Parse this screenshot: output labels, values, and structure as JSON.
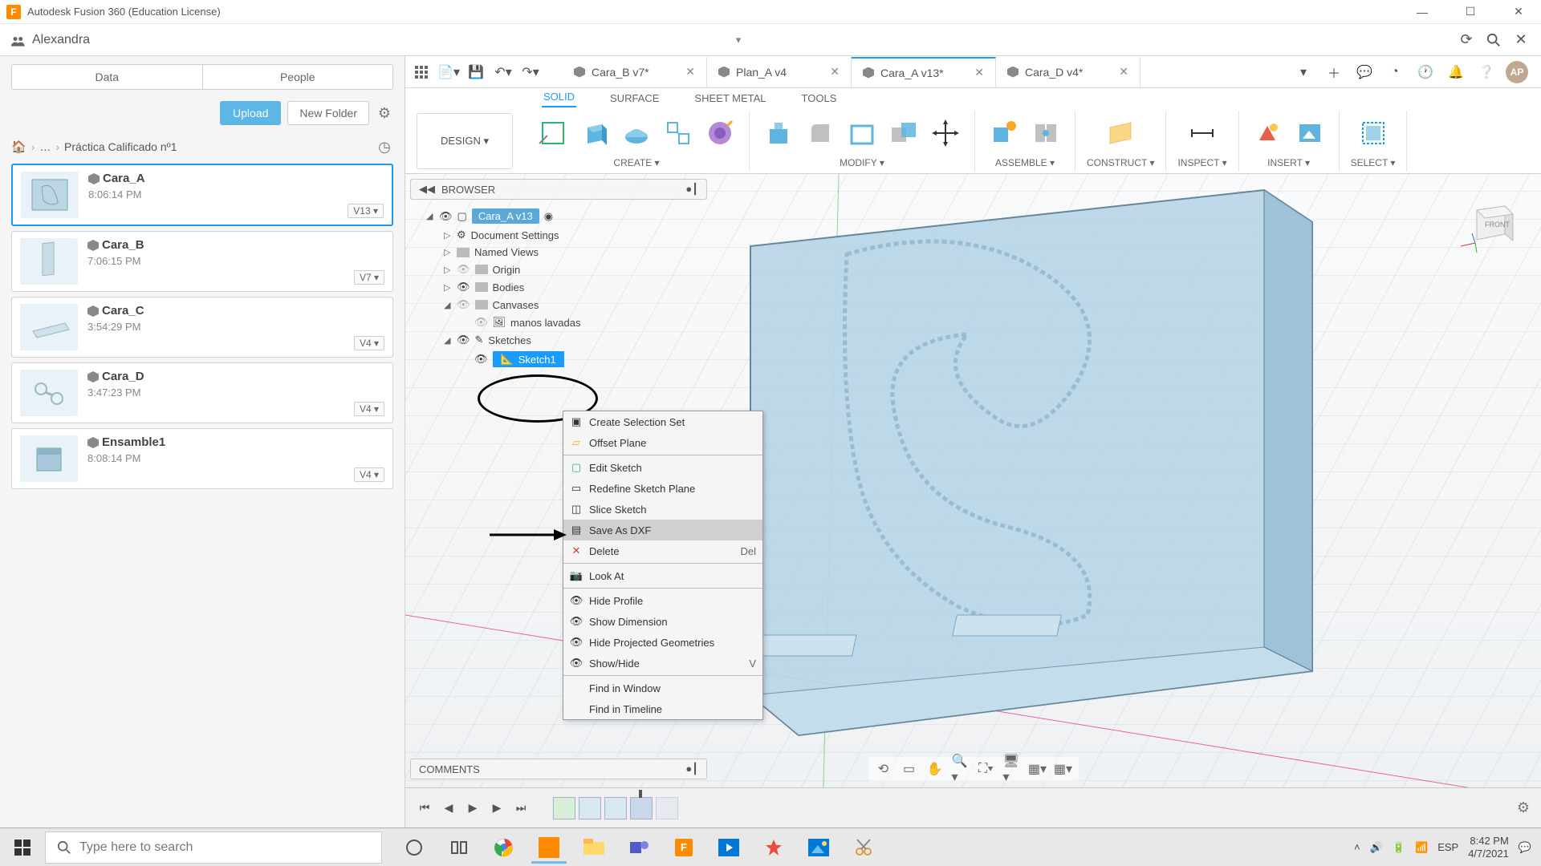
{
  "titlebar": {
    "app_name": "Autodesk Fusion 360 (Education License)"
  },
  "userbar": {
    "username": "Alexandra"
  },
  "left_panel": {
    "tabs": {
      "data": "Data",
      "people": "People"
    },
    "upload": "Upload",
    "new_folder": "New Folder",
    "breadcrumb": "Práctica Calificado nº1",
    "items": [
      {
        "name": "Cara_A",
        "time": "8:06:14 PM",
        "version": "V13 ▾"
      },
      {
        "name": "Cara_B",
        "time": "7:06:15 PM",
        "version": "V7 ▾"
      },
      {
        "name": "Cara_C",
        "time": "3:54:29 PM",
        "version": "V4 ▾"
      },
      {
        "name": "Cara_D",
        "time": "3:47:23 PM",
        "version": "V4 ▾"
      },
      {
        "name": "Ensamble1",
        "time": "8:08:14 PM",
        "version": "V4 ▾"
      }
    ]
  },
  "doc_tabs": [
    {
      "label": "Cara_B v7*"
    },
    {
      "label": "Plan_A v4"
    },
    {
      "label": "Cara_A v13*"
    },
    {
      "label": "Cara_D v4*"
    }
  ],
  "ribbon": {
    "design": "DESIGN ▾",
    "tabs": {
      "solid": "SOLID",
      "surface": "SURFACE",
      "sheet": "SHEET METAL",
      "tools": "TOOLS"
    },
    "groups": {
      "create": "CREATE ▾",
      "modify": "MODIFY ▾",
      "assemble": "ASSEMBLE ▾",
      "construct": "CONSTRUCT ▾",
      "inspect": "INSPECT ▾",
      "insert": "INSERT ▾",
      "select": "SELECT ▾"
    }
  },
  "browser": {
    "title": "BROWSER",
    "root": "Cara_A v13",
    "nodes": {
      "doc_settings": "Document Settings",
      "named_views": "Named Views",
      "origin": "Origin",
      "bodies": "Bodies",
      "canvases": "Canvases",
      "manos": "manos lavadas",
      "sketches": "Sketches",
      "sketch1": "Sketch1"
    }
  },
  "context_menu": {
    "create_sel": "Create Selection Set",
    "offset_plane": "Offset Plane",
    "edit_sketch": "Edit Sketch",
    "redefine": "Redefine Sketch Plane",
    "slice": "Slice Sketch",
    "save_dxf": "Save As DXF",
    "delete": "Delete",
    "delete_sc": "Del",
    "look_at": "Look At",
    "hide_profile": "Hide Profile",
    "show_dim": "Show Dimension",
    "hide_proj": "Hide Projected Geometries",
    "show_hide": "Show/Hide",
    "show_hide_sc": "V",
    "find_win": "Find in Window",
    "find_tl": "Find in Timeline"
  },
  "comments": {
    "title": "COMMENTS"
  },
  "avatar_initials": "AP",
  "taskbar": {
    "search_placeholder": "Type here to search",
    "lang": "ESP",
    "time": "8:42 PM",
    "date": "4/7/2021"
  }
}
